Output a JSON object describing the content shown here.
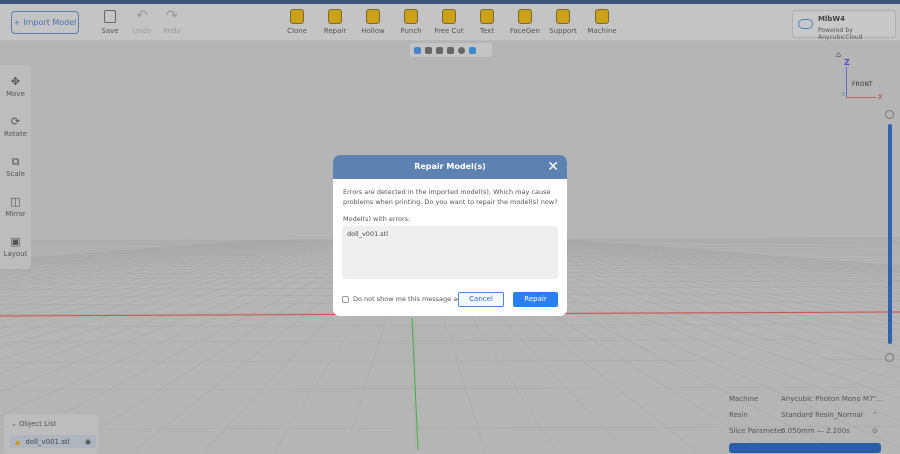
{
  "toolbar": {
    "import_label": "Import Model",
    "file_tools": [
      {
        "label": "Save",
        "icon": "save-icon",
        "enabled": true
      },
      {
        "label": "Undo",
        "icon": "undo-icon",
        "enabled": false
      },
      {
        "label": "Redo",
        "icon": "redo-icon",
        "enabled": false
      }
    ],
    "tools": [
      {
        "label": "Clone",
        "icon": "clone-icon"
      },
      {
        "label": "Repair",
        "icon": "repair-icon"
      },
      {
        "label": "Hollow",
        "icon": "hollow-icon"
      },
      {
        "label": "Punch",
        "icon": "punch-icon"
      },
      {
        "label": "Free Cut",
        "icon": "free-cut-icon"
      },
      {
        "label": "Text",
        "icon": "text-icon"
      },
      {
        "label": "FaceGen",
        "icon": "facegen-icon"
      },
      {
        "label": "Support",
        "icon": "support-icon"
      },
      {
        "label": "Machine",
        "icon": "machine-icon"
      }
    ]
  },
  "account": {
    "name": "MlbW4",
    "subtitle": "Powered by AnycubicCloud"
  },
  "left_tools": [
    {
      "label": "Move",
      "icon": "move-icon"
    },
    {
      "label": "Rotate",
      "icon": "rotate-icon"
    },
    {
      "label": "Scale",
      "icon": "scale-icon"
    },
    {
      "label": "Mirror",
      "icon": "mirror-icon"
    },
    {
      "label": "Layout",
      "icon": "layout-icon"
    }
  ],
  "gizmo": {
    "z": "Z",
    "x": "X",
    "y": "Y",
    "face": "FRONT"
  },
  "object_list": {
    "title": "Object List",
    "items": [
      {
        "name": "doll_v001.stl",
        "warning": true
      }
    ]
  },
  "properties": {
    "machine_label": "Machine",
    "machine_value": "Anycubic Photon Mono M7 ...",
    "resin_label": "Resin",
    "resin_value": "Standard Resin_Normal",
    "slice_label": "Slice Parameter",
    "slice_value": "0.050mm — 2.200s"
  },
  "dialog": {
    "title": "Repair Model(s)",
    "message": "Errors are detected in the imported model(s), Which may cause problems when printing. Do you want to repair the model(s) now?",
    "list_label": "Model(s) with errors:",
    "models": [
      "doll_v001.stl"
    ],
    "checkbox_label": "Do not show me this message again",
    "cancel_label": "Cancel",
    "repair_label": "Repair"
  },
  "colors": {
    "accent": "#2a7ff0",
    "dialog_header": "#5d82b2",
    "x_axis": "#d05050",
    "y_axis": "#40b040"
  }
}
